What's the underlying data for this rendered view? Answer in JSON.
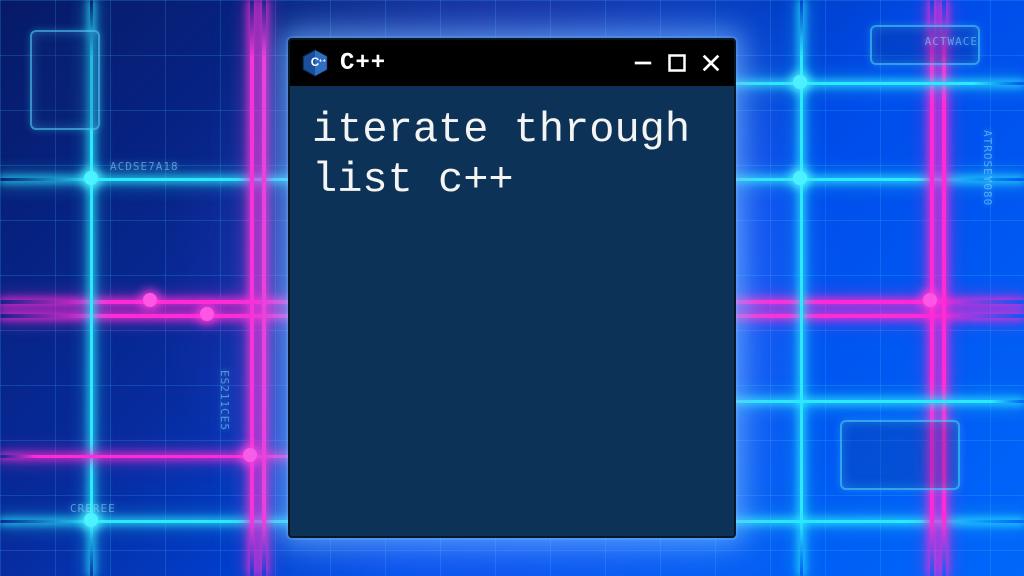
{
  "window": {
    "title": "C++",
    "icon_name": "cpp-hex-icon",
    "controls": {
      "minimize": "minimize",
      "maximize": "maximize",
      "close": "close"
    },
    "body_text": "iterate through list c++"
  },
  "background": {
    "decor_labels": [
      "ACTWACE",
      "CREREE",
      "ES211CE5",
      "ACDSE7A18",
      "ATROSEY080"
    ]
  },
  "colors": {
    "window_bg": "#0c3357",
    "titlebar_bg": "#000000",
    "text": "#f4f4f2",
    "neon_pink": "#ff2bd6",
    "neon_cyan": "#2be9ff"
  }
}
